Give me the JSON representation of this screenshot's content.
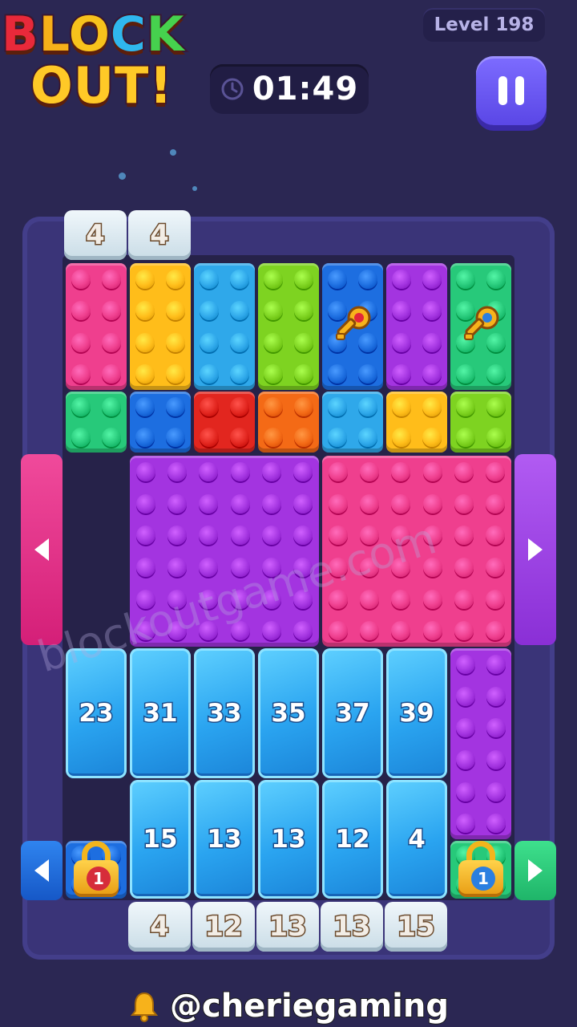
{
  "header": {
    "logo_line1": [
      "B",
      "L",
      "O",
      "C",
      "K"
    ],
    "logo_line2": "OUT!",
    "level_label": "Level 198",
    "timer": "01:49",
    "pause_icon": "pause-icon",
    "clock_icon": "clock-icon"
  },
  "colors": {
    "pink": "#ef3f8e",
    "yellow": "#ffbd1a",
    "cyan": "#2fa8ea",
    "lime": "#7ed321",
    "blue": "#1d6ee0",
    "purple": "#a334e0",
    "green": "#27c97a",
    "red": "#e2261f",
    "orange": "#f46a16"
  },
  "top_counters": [
    "4",
    "4"
  ],
  "ice_row1": [
    "23",
    "31",
    "33",
    "35",
    "37",
    "39"
  ],
  "ice_row2": [
    "15",
    "13",
    "13",
    "12",
    "4"
  ],
  "bottom_counters": [
    "4",
    "12",
    "13",
    "13",
    "15"
  ],
  "locks": [
    "1",
    "1"
  ],
  "watermark": "blockoutgame.com",
  "footer": {
    "bell_icon": "bell-icon",
    "handle": "@cheriegaming"
  }
}
